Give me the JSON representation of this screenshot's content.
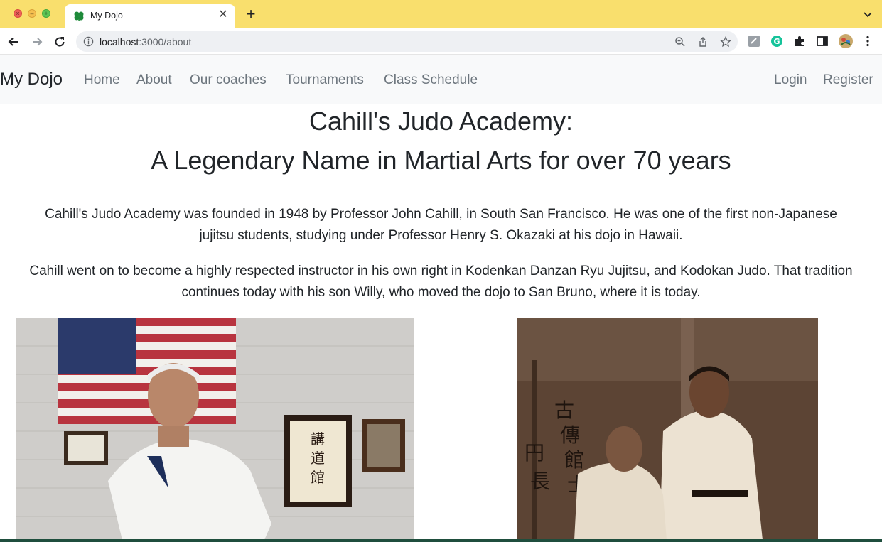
{
  "browser": {
    "tab_title": "My Dojo",
    "url_host": "localhost",
    "url_path": ":3000/about"
  },
  "navbar": {
    "brand": "My Dojo",
    "left_links": [
      "Home",
      "About",
      "Our coaches",
      "Tournaments",
      "Class Schedule"
    ],
    "right_links": [
      "Login",
      "Register"
    ]
  },
  "content": {
    "heading_line1": "Cahill's Judo Academy:",
    "heading_line2": "A Legendary Name in Martial Arts for over 70 years",
    "para1_line1": "Cahill's Judo Academy was founded in 1948 by Professor John Cahill, in South San Francisco. He was one of the first non-Japanese",
    "para1_line2": "jujitsu students, studying under Professor Henry S. Okazaki at his dojo in Hawaii.",
    "para2_line1": "Cahill went on to become a highly respected instructor in his own right in Kodenkan Danzan Ryu Jujitsu, and Kodokan Judo. That tradition",
    "para2_line2": "continues today with his son Willy, who moved the dojo to San Bruno, where it is today."
  },
  "colors": {
    "tabbar": "#f9df6d",
    "navbar_bg": "#f8f9fa",
    "nav_link": "#6c757d",
    "text": "#212529"
  }
}
